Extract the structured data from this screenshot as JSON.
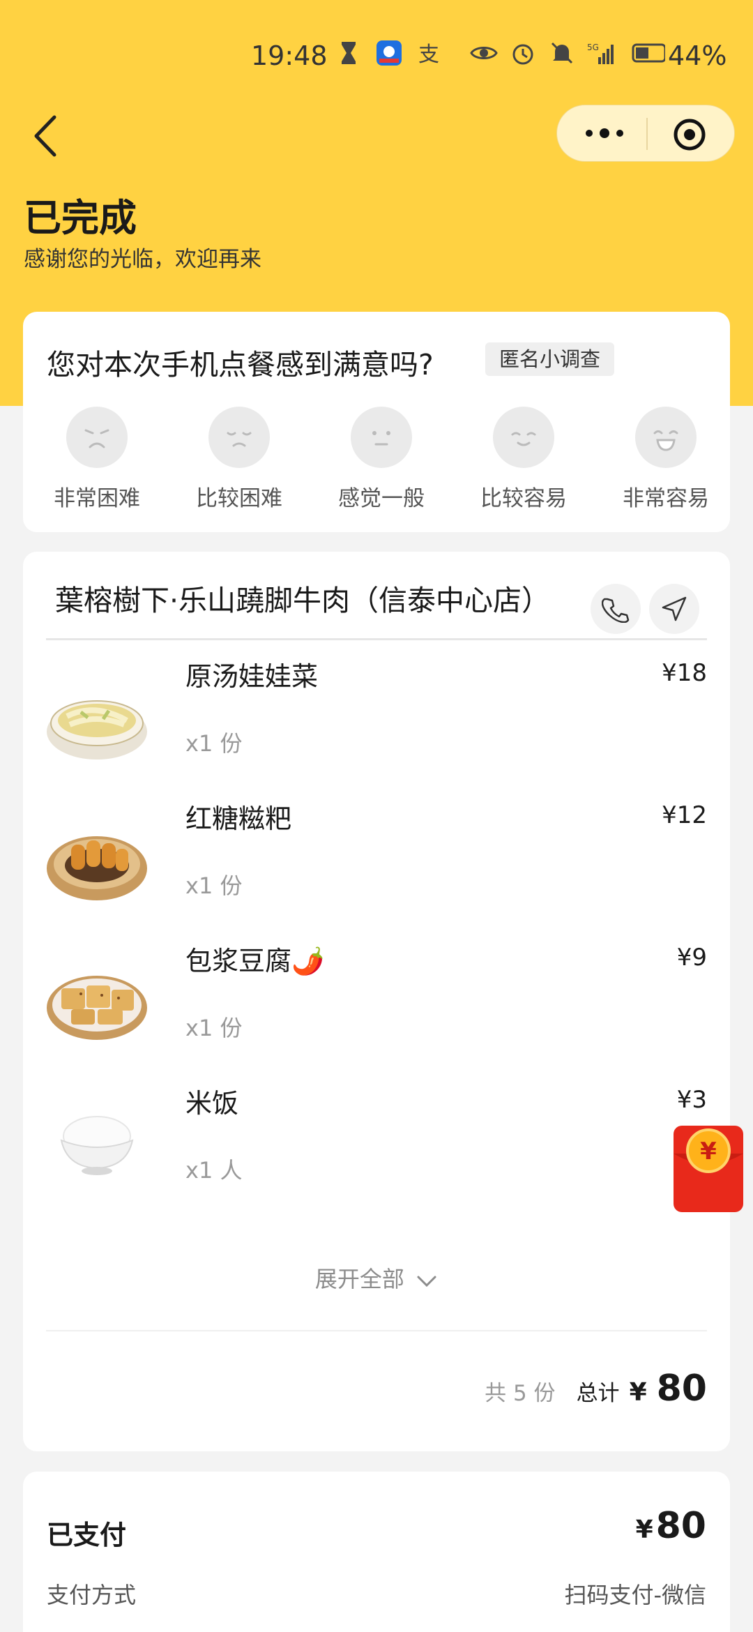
{
  "status_bar": {
    "time": "19:48",
    "battery": "44%",
    "signal": "5G"
  },
  "header": {
    "title": "已完成",
    "subtitle": "感谢您的光临，欢迎再来"
  },
  "survey": {
    "question": "您对本次手机点餐感到满意吗?",
    "tag": "匿名小调查",
    "options": [
      {
        "label": "非常困难",
        "icon": "very-difficult-face-icon"
      },
      {
        "label": "比较困难",
        "icon": "difficult-face-icon"
      },
      {
        "label": "感觉一般",
        "icon": "neutral-face-icon"
      },
      {
        "label": "比较容易",
        "icon": "easy-face-icon"
      },
      {
        "label": "非常容易",
        "icon": "very-easy-face-icon"
      }
    ]
  },
  "order": {
    "shop_name": "葉榕樹下·乐山蹺脚牛肉（信泰中心店）",
    "items": [
      {
        "name": "原汤娃娃菜",
        "qty": "x1 份",
        "price": "¥18"
      },
      {
        "name": "红糖糍粑",
        "qty": "x1 份",
        "price": "¥12"
      },
      {
        "name": "包浆豆腐🌶️",
        "qty": "x1 份",
        "price": "¥9"
      },
      {
        "name": "米饭",
        "qty": "x1 人",
        "price": "¥3"
      }
    ],
    "expand_label": "展开全部",
    "count_label": "共 5 份",
    "total_label": "总计",
    "currency": "¥",
    "total": "80"
  },
  "payment": {
    "status": "已支付",
    "currency": "¥",
    "amount": "80",
    "method_label": "支付方式",
    "method_value": "扫码支付-微信"
  },
  "colors": {
    "header_bg": "#ffd242",
    "red_packet": "#e8291b"
  }
}
